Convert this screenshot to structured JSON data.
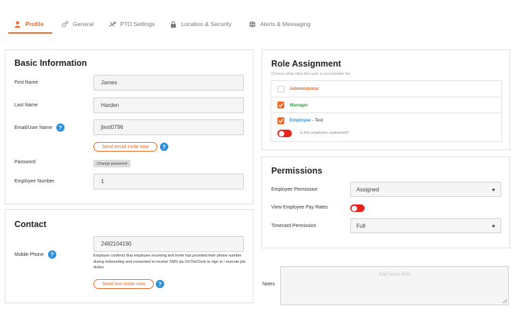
{
  "tabs": [
    {
      "label": "Profile",
      "icon": "person-icon"
    },
    {
      "label": "General",
      "icon": "gears-icon"
    },
    {
      "label": "PTO Settings",
      "icon": "plane-icon"
    },
    {
      "label": "Location & Security",
      "icon": "lock-icon"
    },
    {
      "label": "Alerts & Messaging",
      "icon": "globe-icon"
    }
  ],
  "basic": {
    "title": "Basic Information",
    "first_name_label": "First Name",
    "first_name": "James",
    "last_name_label": "Last Name",
    "last_name": "Harden",
    "email_label": "Email/User Name",
    "email": "jtest0796",
    "send_email_label": "Send email invite now",
    "password_label": "Password",
    "change_password_label": "Change password",
    "employee_number_label": "Employee Number",
    "employee_number": "1"
  },
  "contact": {
    "title": "Contact",
    "mobile_label": "Mobile Phone",
    "mobile": "2482104190",
    "disclaimer": "Employer confirms that employee receiving text invite has provided their phone number during onboarding and consented to receive SMS via OnTheClock to sign in / execute job duties.",
    "send_text_label": "Send text invite now"
  },
  "roles": {
    "title": "Role Assignment",
    "subtitle": "Choose what roles this user is accountable for.",
    "administrator": "Administrator",
    "manager": "Manager",
    "employee": "Employee",
    "employee_suffix": " - Test",
    "contracted_label": "Is this employee contracted?",
    "colors": {
      "administrator": "#f26522",
      "manager": "#2e9e3e",
      "employee": "#2b8fd9"
    }
  },
  "permissions": {
    "title": "Permissions",
    "employee_permission_label": "Employee Permission",
    "employee_permission_value": "Assigned",
    "pay_rates_label": "View Employee Pay Rates",
    "timecard_label": "Timecard Permission",
    "timecard_value": "Full"
  },
  "notes": {
    "label": "Notes",
    "placeholder": "Add notes field"
  },
  "colors": {
    "accent": "#f26522",
    "help": "#2b8fd9",
    "toggle_off": "#e5261e"
  }
}
